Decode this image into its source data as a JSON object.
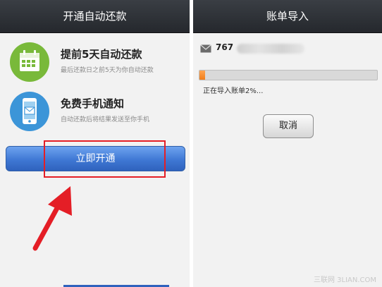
{
  "left": {
    "title": "开通自动还款",
    "features": [
      {
        "title": "提前5天自动还款",
        "desc": "最后还款日之前5天为你自动还款",
        "icon": "calendar-icon"
      },
      {
        "title": "免费手机通知",
        "desc": "自动还款后将结果发送至你手机",
        "icon": "phone-mail-icon"
      }
    ],
    "primary_button": "立即开通"
  },
  "right": {
    "title": "账单导入",
    "email_prefix": "767",
    "progress_fraction": 0.02,
    "status": "正在导入账单2%...",
    "cancel_button": "取消"
  },
  "colors": {
    "title_bar": "#2f3338",
    "primary_button": "#3f78d4",
    "progress": "#f07d1b",
    "highlight": "#e41e26",
    "calendar_icon_bg": "#79b93a",
    "phone_icon_bg": "#3c95d8"
  }
}
